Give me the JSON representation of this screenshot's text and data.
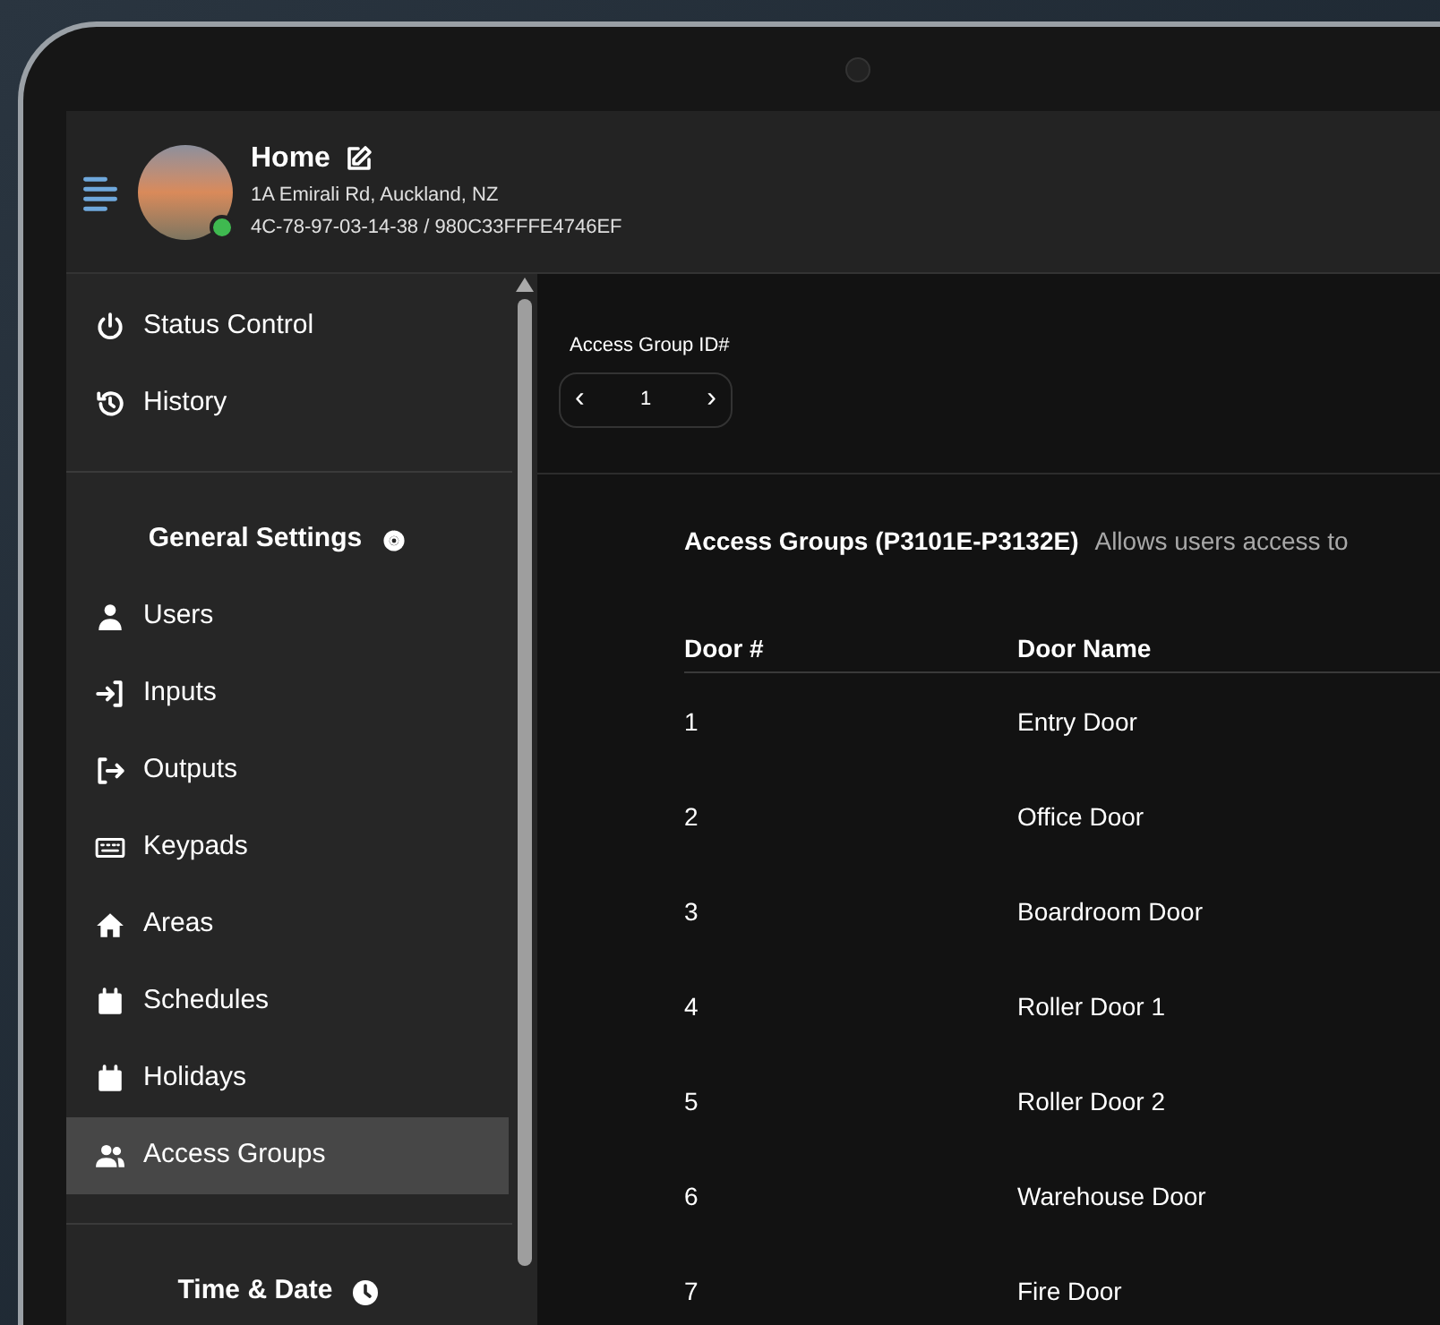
{
  "header": {
    "title": "Home",
    "address": "1A Emirali Rd, Auckland, NZ",
    "ids": "4C-78-97-03-14-38 / 980C33FFFE4746EF",
    "online": true
  },
  "sidebar": {
    "items": [
      {
        "kind": "item",
        "label": "Status Control",
        "selected": false
      },
      {
        "kind": "item",
        "label": "History",
        "selected": false
      },
      {
        "kind": "divider"
      },
      {
        "kind": "heading",
        "label": "General Settings"
      },
      {
        "kind": "item",
        "label": "Users",
        "selected": false
      },
      {
        "kind": "item",
        "label": "Inputs",
        "selected": false
      },
      {
        "kind": "item",
        "label": "Outputs",
        "selected": false
      },
      {
        "kind": "item",
        "label": "Keypads",
        "selected": false
      },
      {
        "kind": "item",
        "label": "Areas",
        "selected": false
      },
      {
        "kind": "item",
        "label": "Schedules",
        "selected": false
      },
      {
        "kind": "item",
        "label": "Holidays",
        "selected": false
      },
      {
        "kind": "item",
        "label": "Access Groups",
        "selected": true
      },
      {
        "kind": "divider"
      },
      {
        "kind": "heading",
        "label": "Time & Date"
      }
    ]
  },
  "group_id": {
    "label": "Access Group ID#",
    "prev": "‹",
    "value": "1",
    "next": "›"
  },
  "section": {
    "title": "Access Groups (P3101E-P3132E)",
    "description": "Allows users access to"
  },
  "table": {
    "columns": [
      "Door #",
      "Door Name"
    ],
    "rows": [
      [
        "1",
        "Entry Door"
      ],
      [
        "2",
        "Office Door"
      ],
      [
        "3",
        "Boardroom Door"
      ],
      [
        "4",
        "Roller Door 1"
      ],
      [
        "5",
        "Roller Door 2"
      ],
      [
        "6",
        "Warehouse Door"
      ],
      [
        "7",
        "Fire Door"
      ]
    ]
  }
}
